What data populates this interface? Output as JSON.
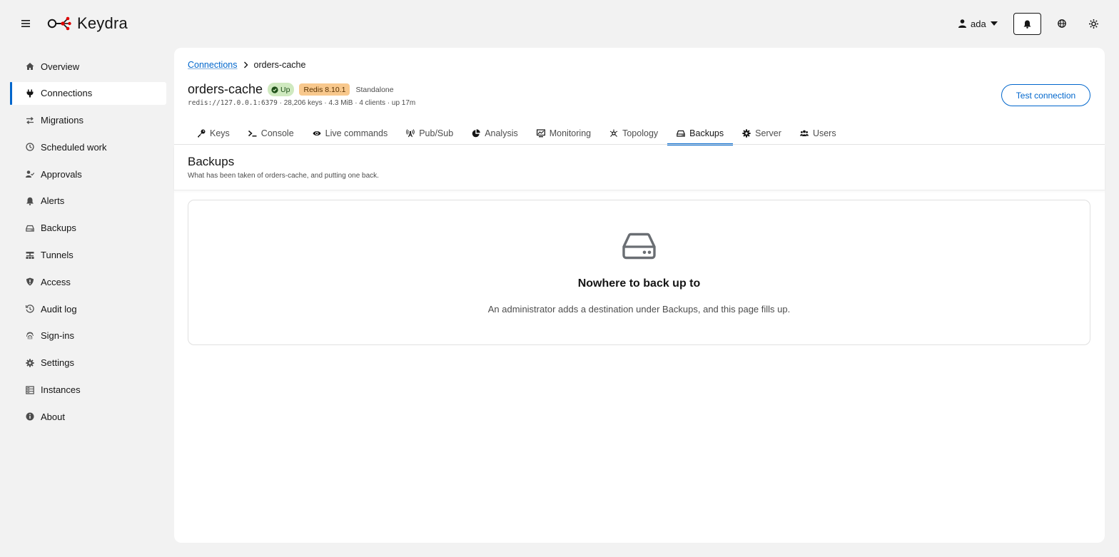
{
  "app": {
    "name": "Keydra"
  },
  "user": {
    "name": "ada"
  },
  "sidebar": {
    "items": [
      {
        "label": "Overview",
        "icon": "home-icon"
      },
      {
        "label": "Connections",
        "icon": "plug-icon",
        "active": true
      },
      {
        "label": "Migrations",
        "icon": "exchange-icon"
      },
      {
        "label": "Scheduled work",
        "icon": "clock-icon"
      },
      {
        "label": "Approvals",
        "icon": "user-check-icon"
      },
      {
        "label": "Alerts",
        "icon": "bell-icon"
      },
      {
        "label": "Backups",
        "icon": "hdd-icon"
      },
      {
        "label": "Tunnels",
        "icon": "network-icon"
      },
      {
        "label": "Access",
        "icon": "shield-icon"
      },
      {
        "label": "Audit log",
        "icon": "history-icon"
      },
      {
        "label": "Sign-ins",
        "icon": "fingerprint-icon"
      },
      {
        "label": "Settings",
        "icon": "gear-icon"
      },
      {
        "label": "Instances",
        "icon": "server-icon"
      },
      {
        "label": "About",
        "icon": "info-icon"
      }
    ]
  },
  "breadcrumb": {
    "parent": "Connections",
    "current": "orders-cache"
  },
  "connection": {
    "name": "orders-cache",
    "status": "Up",
    "version": "Redis 8.10.1",
    "mode": "Standalone",
    "url": "redis://127.0.0.1:6379",
    "stats": " · 28,206 keys · 4.3 MiB · 4 clients · up 17m"
  },
  "actions": {
    "test_connection": "Test connection"
  },
  "tabs": [
    {
      "label": "Keys",
      "icon": "key-icon"
    },
    {
      "label": "Console",
      "icon": "terminal-icon"
    },
    {
      "label": "Live commands",
      "icon": "eye-icon"
    },
    {
      "label": "Pub/Sub",
      "icon": "broadcast-icon"
    },
    {
      "label": "Analysis",
      "icon": "pie-chart-icon"
    },
    {
      "label": "Monitoring",
      "icon": "chart-monitor-icon"
    },
    {
      "label": "Topology",
      "icon": "topology-icon"
    },
    {
      "label": "Backups",
      "icon": "hdd-icon",
      "active": true
    },
    {
      "label": "Server",
      "icon": "gear-icon"
    },
    {
      "label": "Users",
      "icon": "users-icon"
    }
  ],
  "section": {
    "title": "Backups",
    "subtitle": "What has been taken of orders-cache, and putting one back."
  },
  "empty_state": {
    "icon": "hdd-icon",
    "title": "Nowhere to back up to",
    "text": "An administrator adds a destination under Backups, and this page fills up."
  },
  "colors": {
    "accent": "#0066cc",
    "up_badge": "#cfe9bf",
    "version_badge": "#f8c88d",
    "background": "#f2f2f2"
  }
}
